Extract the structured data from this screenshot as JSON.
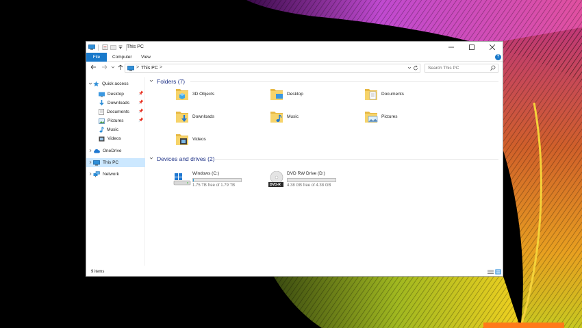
{
  "window": {
    "title": "This PC"
  },
  "ribbon": {
    "tabs": [
      "File",
      "Computer",
      "View"
    ],
    "help": "?"
  },
  "address": {
    "location": "This PC",
    "separator": ">",
    "search_placeholder": "Search This PC"
  },
  "sidebar": {
    "quick_access": "Quick access",
    "pinned": [
      {
        "label": "Desktop",
        "icon": "desktop-icon",
        "pinned": true
      },
      {
        "label": "Downloads",
        "icon": "downloads-icon",
        "pinned": true
      },
      {
        "label": "Documents",
        "icon": "documents-icon",
        "pinned": true
      },
      {
        "label": "Pictures",
        "icon": "pictures-icon",
        "pinned": true
      },
      {
        "label": "Music",
        "icon": "music-icon",
        "pinned": false
      },
      {
        "label": "Videos",
        "icon": "videos-icon",
        "pinned": false
      }
    ],
    "onedrive": "OneDrive",
    "this_pc": "This PC",
    "network": "Network"
  },
  "folders": {
    "header": "Folders (7)",
    "items": [
      {
        "label": "3D Objects",
        "icon": "3d-objects-folder-icon"
      },
      {
        "label": "Desktop",
        "icon": "desktop-folder-icon"
      },
      {
        "label": "Documents",
        "icon": "documents-folder-icon"
      },
      {
        "label": "Downloads",
        "icon": "downloads-folder-icon"
      },
      {
        "label": "Music",
        "icon": "music-folder-icon"
      },
      {
        "label": "Pictures",
        "icon": "pictures-folder-icon"
      },
      {
        "label": "Videos",
        "icon": "videos-folder-icon"
      }
    ]
  },
  "drives": {
    "header": "Devices and drives (2)",
    "items": [
      {
        "name": "Windows (C:)",
        "free": "1.75 TB free of 1.79 TB",
        "used_fraction": 0.02,
        "icon": "windows-drive-icon"
      },
      {
        "name": "DVD RW Drive (D:)",
        "free": "4.38 GB free of 4.38 GB",
        "used_fraction": 0.0,
        "icon": "dvd-drive-icon",
        "badge": "DVD-R"
      }
    ]
  },
  "status": {
    "item_count": "9 items"
  },
  "colors": {
    "accent": "#1979ca",
    "header_text": "#1e3287",
    "selection": "#cce8ff",
    "drive_fill": "#26a0da",
    "folder": "#f6d36a"
  }
}
